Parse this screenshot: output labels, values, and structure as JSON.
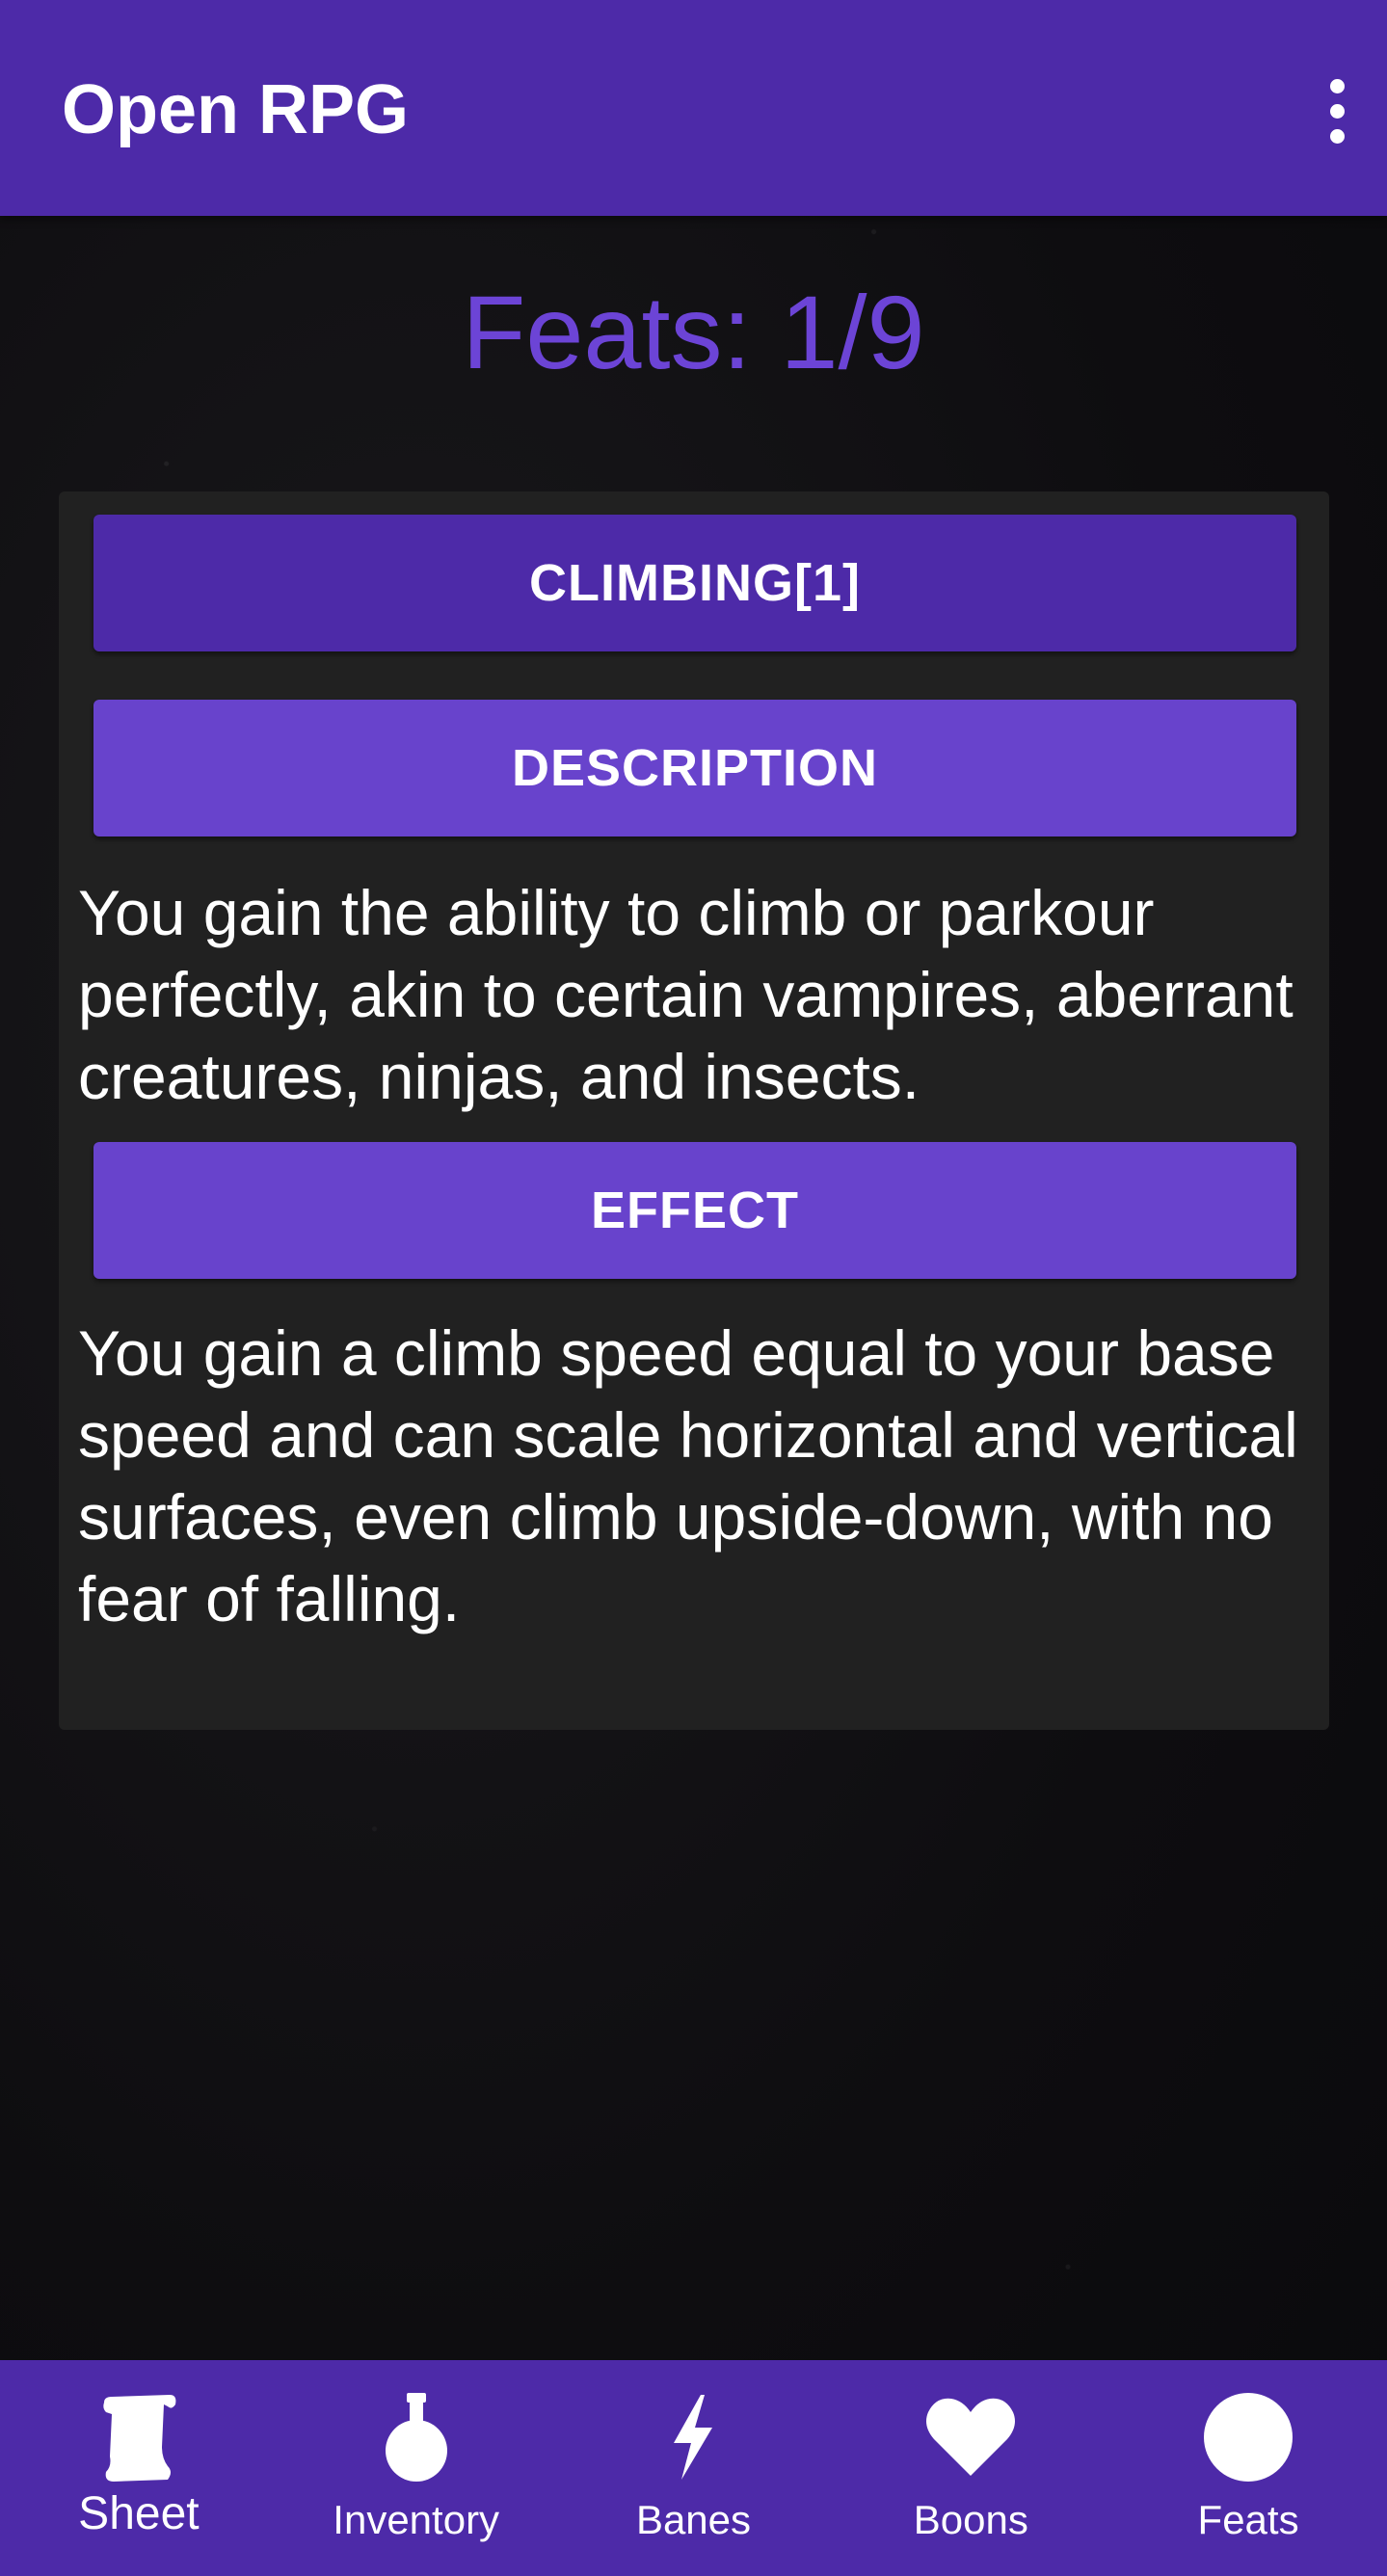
{
  "app_bar": {
    "title": "Open RPG",
    "menu_icon": "more-vert-icon"
  },
  "heading": "Feats: 1/9",
  "feat": {
    "title_button": "CLIMBING[1]",
    "description_button": "DESCRIPTION",
    "description_text": "You gain the ability to climb or parkour perfectly, akin to certain vampires, aberrant creatures, ninjas, and insects.",
    "effect_button": "EFFECT",
    "effect_text": "You gain a climb speed equal to your base speed and can scale horizontal and vertical surfaces, even climb upside-down, with no fear of falling."
  },
  "bottom_nav": {
    "selected": "Sheet",
    "items": [
      {
        "label": "Sheet",
        "icon": "scroll-icon"
      },
      {
        "label": "Inventory",
        "icon": "potion-icon"
      },
      {
        "label": "Banes",
        "icon": "lightning-icon"
      },
      {
        "label": "Boons",
        "icon": "heart-icon"
      },
      {
        "label": "Feats",
        "icon": "circle-icon"
      }
    ]
  },
  "colors": {
    "primary": "#4d2aa8",
    "accent": "#6843cc",
    "heading": "#6c44d6",
    "card": "#212121"
  }
}
